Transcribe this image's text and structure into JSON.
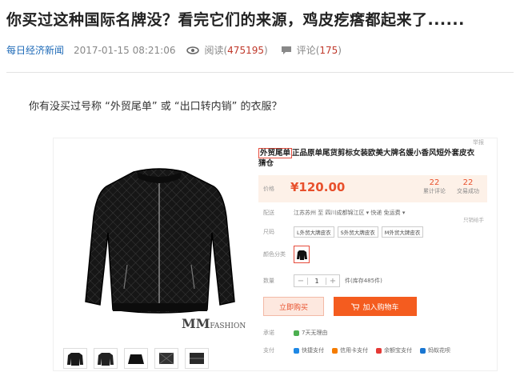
{
  "article": {
    "title": "你买过这种国际名牌没？看完它们的来源，鸡皮疙瘩都起来了......",
    "source": "每日经济新闻",
    "date": "2017-01-15 08:21:06",
    "read_label": "阅读",
    "read_count": "475195",
    "comment_label": "评论",
    "comment_count": "175",
    "lead": "你有没买过号称 “外贸尾单” 或 “出口转内销” 的衣服？"
  },
  "product": {
    "top_tag": "举报",
    "title_highlight": "外贸尾单",
    "title_rest": "正品原单尾货剪标女装欧美大牌名媛小香风短外套皮衣",
    "title_line2": "猜仓",
    "price_label": "价格",
    "price": "¥120.00",
    "reviews_count": "22",
    "reviews_label": "累计评论",
    "sales_count": "22",
    "sales_label": "交易成功",
    "shipping_label": "配送",
    "shipping_text": "江苏苏州 至  四川成都锦江区 ▾   快递 免运费 ▾",
    "side_note": "只销给手",
    "size_label": "尺码",
    "sizes": [
      "L外贸大牌皮衣",
      "S外贸大牌皮衣",
      "M外贸大牌皮衣"
    ],
    "color_label": "颜色分类",
    "qty_label": "数量",
    "qty_minus": "−",
    "qty_value": "1",
    "qty_plus": "+",
    "stock_text": "件(库存485件)",
    "buy_now": "立即购买",
    "add_cart": "加入购物车",
    "promise_label": "承诺",
    "promise_text": "7天无理由",
    "payment_label": "支付",
    "payments": [
      "快捷支付",
      "信用卡支付",
      "余额宝支付",
      "蚂蚁花呗"
    ],
    "watermark_brand": "MM",
    "watermark_text": "FASHION"
  },
  "colors": {
    "accent": "#e8502c",
    "link": "#1f6bb8",
    "count": "#c0392b"
  }
}
